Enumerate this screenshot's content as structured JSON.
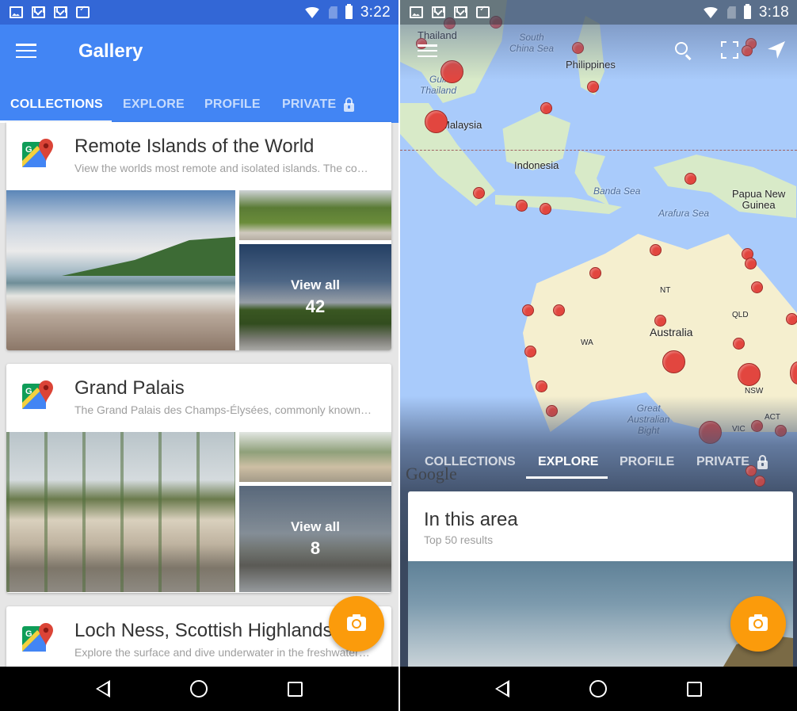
{
  "left_screen": {
    "status_bar": {
      "notification_icons": [
        "gallery-icon",
        "gmail-stack-icon",
        "gmail-icon",
        "clipboard-check-icon"
      ],
      "time": "3:22"
    },
    "app_bar": {
      "title": "Gallery",
      "menu_icon": "hamburger-menu-icon"
    },
    "tabs": [
      {
        "label": "COLLECTIONS",
        "active": true
      },
      {
        "label": "EXPLORE",
        "active": false
      },
      {
        "label": "PROFILE",
        "active": false
      },
      {
        "label": "PRIVATE",
        "active": false,
        "icon": "lock-icon"
      }
    ],
    "collections": [
      {
        "title": "Remote Islands of the World",
        "description": "View the worlds most remote and isolated islands. The co…",
        "view_all_label": "View all",
        "count": "42"
      },
      {
        "title": "Grand Palais",
        "description": "The Grand Palais des Champs-Élysées, commonly known…",
        "view_all_label": "View all",
        "count": "8"
      },
      {
        "title": "Loch Ness, Scottish Highlands",
        "description": "Explore the surface and dive underwater in the freshwater…"
      }
    ],
    "fab_icon": "camera-icon"
  },
  "right_screen": {
    "status_bar": {
      "notification_icons": [
        "gallery-icon",
        "gmail-stack-icon",
        "gmail-icon",
        "clipboard-check-icon"
      ],
      "time": "3:18"
    },
    "map_toolbar": [
      "hamburger-menu-icon",
      "search-icon",
      "fullscreen-icon",
      "navigation-arrow-icon"
    ],
    "map_labels": {
      "thailand": "Thailand",
      "south_china_sea": "South\nChina Sea",
      "philippines": "Philippines",
      "gulf_thailand": "Gulf\nThailand",
      "malaysia": "Malaysia",
      "indonesia": "Indonesia",
      "banda_sea": "Banda Sea",
      "papua": "Papua New\nGuinea",
      "arafura_sea": "Arafura Sea",
      "nt": "NT",
      "australia": "Australia",
      "qld": "QLD",
      "wa": "WA",
      "nsw": "NSW",
      "great_bight": "Great\nAustralian\nBight",
      "act": "ACT",
      "vic": "VIC"
    },
    "map_watermark": "Google",
    "tabs": [
      {
        "label": "COLLECTIONS",
        "active": false
      },
      {
        "label": "EXPLORE",
        "active": true
      },
      {
        "label": "PROFILE",
        "active": false
      },
      {
        "label": "PRIVATE",
        "active": false,
        "icon": "lock-icon"
      }
    ],
    "area_card": {
      "title": "In this area",
      "subtitle": "Top 50 results"
    },
    "fab_icon": "camera-icon"
  },
  "nav_bar": [
    "back-icon",
    "home-icon",
    "recents-icon"
  ],
  "colors": {
    "primary": "#4285f4",
    "status_bar": "#3367d6",
    "fab": "#fb9b0b",
    "marker": "#e2463f",
    "water": "#a9cbfb"
  }
}
